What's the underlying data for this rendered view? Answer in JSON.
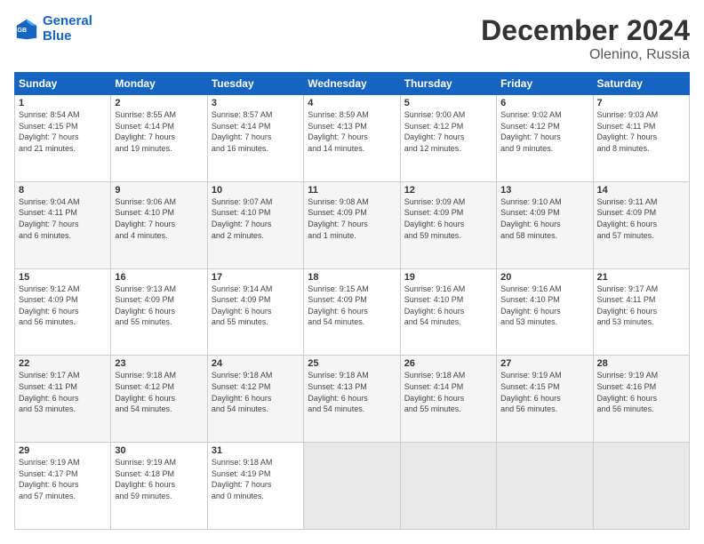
{
  "header": {
    "logo_line1": "General",
    "logo_line2": "Blue",
    "title": "December 2024",
    "subtitle": "Olenino, Russia"
  },
  "columns": [
    "Sunday",
    "Monday",
    "Tuesday",
    "Wednesday",
    "Thursday",
    "Friday",
    "Saturday"
  ],
  "weeks": [
    [
      {
        "day": "1",
        "info": "Sunrise: 8:54 AM\nSunset: 4:15 PM\nDaylight: 7 hours\nand 21 minutes."
      },
      {
        "day": "2",
        "info": "Sunrise: 8:55 AM\nSunset: 4:14 PM\nDaylight: 7 hours\nand 19 minutes."
      },
      {
        "day": "3",
        "info": "Sunrise: 8:57 AM\nSunset: 4:14 PM\nDaylight: 7 hours\nand 16 minutes."
      },
      {
        "day": "4",
        "info": "Sunrise: 8:59 AM\nSunset: 4:13 PM\nDaylight: 7 hours\nand 14 minutes."
      },
      {
        "day": "5",
        "info": "Sunrise: 9:00 AM\nSunset: 4:12 PM\nDaylight: 7 hours\nand 12 minutes."
      },
      {
        "day": "6",
        "info": "Sunrise: 9:02 AM\nSunset: 4:12 PM\nDaylight: 7 hours\nand 9 minutes."
      },
      {
        "day": "7",
        "info": "Sunrise: 9:03 AM\nSunset: 4:11 PM\nDaylight: 7 hours\nand 8 minutes."
      }
    ],
    [
      {
        "day": "8",
        "info": "Sunrise: 9:04 AM\nSunset: 4:11 PM\nDaylight: 7 hours\nand 6 minutes."
      },
      {
        "day": "9",
        "info": "Sunrise: 9:06 AM\nSunset: 4:10 PM\nDaylight: 7 hours\nand 4 minutes."
      },
      {
        "day": "10",
        "info": "Sunrise: 9:07 AM\nSunset: 4:10 PM\nDaylight: 7 hours\nand 2 minutes."
      },
      {
        "day": "11",
        "info": "Sunrise: 9:08 AM\nSunset: 4:09 PM\nDaylight: 7 hours\nand 1 minute."
      },
      {
        "day": "12",
        "info": "Sunrise: 9:09 AM\nSunset: 4:09 PM\nDaylight: 6 hours\nand 59 minutes."
      },
      {
        "day": "13",
        "info": "Sunrise: 9:10 AM\nSunset: 4:09 PM\nDaylight: 6 hours\nand 58 minutes."
      },
      {
        "day": "14",
        "info": "Sunrise: 9:11 AM\nSunset: 4:09 PM\nDaylight: 6 hours\nand 57 minutes."
      }
    ],
    [
      {
        "day": "15",
        "info": "Sunrise: 9:12 AM\nSunset: 4:09 PM\nDaylight: 6 hours\nand 56 minutes."
      },
      {
        "day": "16",
        "info": "Sunrise: 9:13 AM\nSunset: 4:09 PM\nDaylight: 6 hours\nand 55 minutes."
      },
      {
        "day": "17",
        "info": "Sunrise: 9:14 AM\nSunset: 4:09 PM\nDaylight: 6 hours\nand 55 minutes."
      },
      {
        "day": "18",
        "info": "Sunrise: 9:15 AM\nSunset: 4:09 PM\nDaylight: 6 hours\nand 54 minutes."
      },
      {
        "day": "19",
        "info": "Sunrise: 9:16 AM\nSunset: 4:10 PM\nDaylight: 6 hours\nand 54 minutes."
      },
      {
        "day": "20",
        "info": "Sunrise: 9:16 AM\nSunset: 4:10 PM\nDaylight: 6 hours\nand 53 minutes."
      },
      {
        "day": "21",
        "info": "Sunrise: 9:17 AM\nSunset: 4:11 PM\nDaylight: 6 hours\nand 53 minutes."
      }
    ],
    [
      {
        "day": "22",
        "info": "Sunrise: 9:17 AM\nSunset: 4:11 PM\nDaylight: 6 hours\nand 53 minutes."
      },
      {
        "day": "23",
        "info": "Sunrise: 9:18 AM\nSunset: 4:12 PM\nDaylight: 6 hours\nand 54 minutes."
      },
      {
        "day": "24",
        "info": "Sunrise: 9:18 AM\nSunset: 4:12 PM\nDaylight: 6 hours\nand 54 minutes."
      },
      {
        "day": "25",
        "info": "Sunrise: 9:18 AM\nSunset: 4:13 PM\nDaylight: 6 hours\nand 54 minutes."
      },
      {
        "day": "26",
        "info": "Sunrise: 9:18 AM\nSunset: 4:14 PM\nDaylight: 6 hours\nand 55 minutes."
      },
      {
        "day": "27",
        "info": "Sunrise: 9:19 AM\nSunset: 4:15 PM\nDaylight: 6 hours\nand 56 minutes."
      },
      {
        "day": "28",
        "info": "Sunrise: 9:19 AM\nSunset: 4:16 PM\nDaylight: 6 hours\nand 56 minutes."
      }
    ],
    [
      {
        "day": "29",
        "info": "Sunrise: 9:19 AM\nSunset: 4:17 PM\nDaylight: 6 hours\nand 57 minutes."
      },
      {
        "day": "30",
        "info": "Sunrise: 9:19 AM\nSunset: 4:18 PM\nDaylight: 6 hours\nand 59 minutes."
      },
      {
        "day": "31",
        "info": "Sunrise: 9:18 AM\nSunset: 4:19 PM\nDaylight: 7 hours\nand 0 minutes."
      },
      {
        "day": "",
        "info": ""
      },
      {
        "day": "",
        "info": ""
      },
      {
        "day": "",
        "info": ""
      },
      {
        "day": "",
        "info": ""
      }
    ]
  ]
}
